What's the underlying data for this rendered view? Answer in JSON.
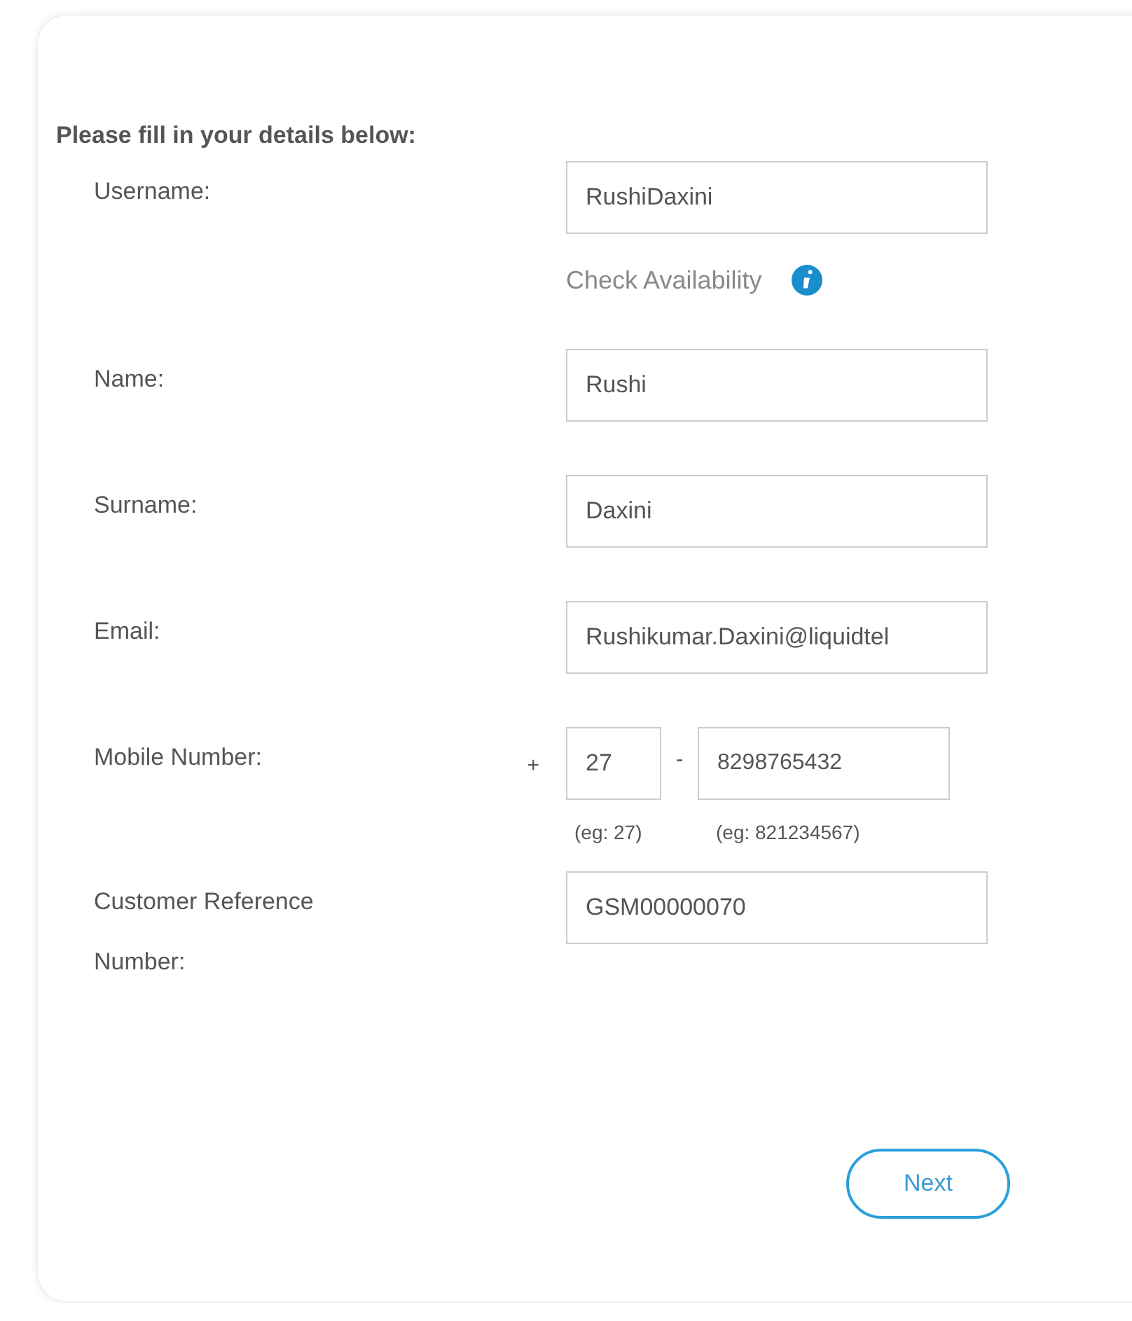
{
  "heading": "Please fill in your details below:",
  "fields": [
    {
      "kind": "text",
      "label": "Username:",
      "value": "RushiDaxini"
    },
    {
      "kind": "note",
      "text": "Check Availability"
    },
    {
      "kind": "text",
      "label": "Name:",
      "value": "Rushi"
    },
    {
      "kind": "text",
      "label": "Surname:",
      "value": "Daxini"
    },
    {
      "kind": "text",
      "label": "Email:",
      "value": "Rushikumar.Daxini@liquidtel"
    },
    {
      "kind": "phone",
      "label": "Mobile Number:",
      "prefix": "+",
      "code": "27",
      "separator": "-",
      "number": "8298765432",
      "code_hint": "(eg: 27)",
      "number_hint": "(eg: 821234567)"
    },
    {
      "kind": "text",
      "label": "Customer Reference Number:",
      "value": "GSM00000070"
    }
  ],
  "buttons": [
    "Next"
  ]
}
